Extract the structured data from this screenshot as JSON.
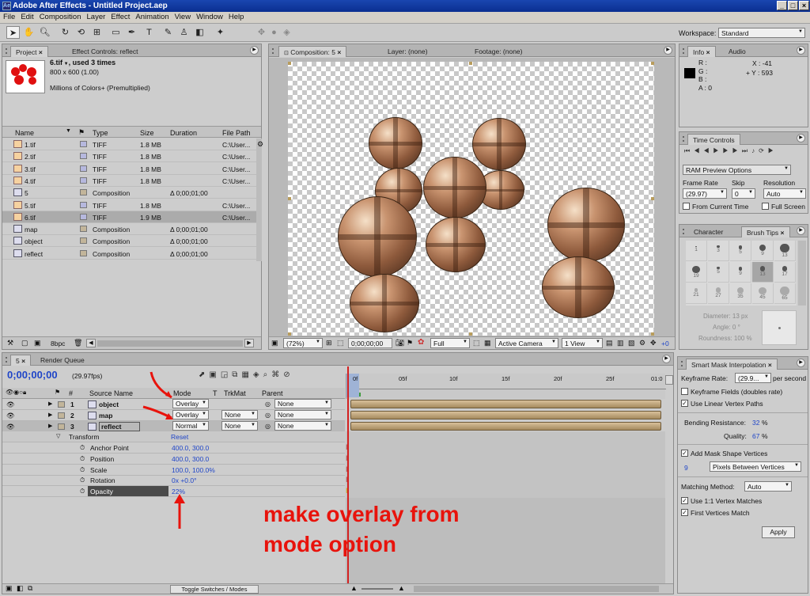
{
  "window": {
    "title": "Adobe After Effects - Untitled Project.aep"
  },
  "menu": [
    "File",
    "Edit",
    "Composition",
    "Layer",
    "Effect",
    "Animation",
    "View",
    "Window",
    "Help"
  ],
  "workspace": {
    "label": "Workspace:",
    "value": "Standard"
  },
  "project": {
    "tabs": [
      "Project",
      "Effect Controls: reflect"
    ],
    "item_name": "6.tif",
    "item_used": ", used 3 times",
    "item_size": "800 x 600 (1.00)",
    "item_color": "Millions of Colors+ (Premultiplied)",
    "columns": [
      "Name",
      "Type",
      "Size",
      "Duration",
      "File Path"
    ],
    "rows": [
      {
        "name": "1.tif",
        "type": "TIFF",
        "size": "1.8 MB",
        "duration": "",
        "path": "C:\\User...",
        "kind": "file"
      },
      {
        "name": "2.tif",
        "type": "TIFF",
        "size": "1.8 MB",
        "duration": "",
        "path": "C:\\User...",
        "kind": "file"
      },
      {
        "name": "3.tif",
        "type": "TIFF",
        "size": "1.8 MB",
        "duration": "",
        "path": "C:\\User...",
        "kind": "file"
      },
      {
        "name": "4.tif",
        "type": "TIFF",
        "size": "1.8 MB",
        "duration": "",
        "path": "C:\\User...",
        "kind": "file"
      },
      {
        "name": "5",
        "type": "Composition",
        "size": "",
        "duration": "Δ 0;00;01;00",
        "path": "",
        "kind": "comp"
      },
      {
        "name": "5.tif",
        "type": "TIFF",
        "size": "1.8 MB",
        "duration": "",
        "path": "C:\\User...",
        "kind": "file"
      },
      {
        "name": "6.tif",
        "type": "TIFF",
        "size": "1.9 MB",
        "duration": "",
        "path": "C:\\User...",
        "kind": "file"
      },
      {
        "name": "map",
        "type": "Composition",
        "size": "",
        "duration": "Δ 0;00;01;00",
        "path": "",
        "kind": "comp"
      },
      {
        "name": "object",
        "type": "Composition",
        "size": "",
        "duration": "Δ 0;00;01;00",
        "path": "",
        "kind": "comp"
      },
      {
        "name": "reflect",
        "type": "Composition",
        "size": "",
        "duration": "Δ 0;00;01;00",
        "path": "",
        "kind": "comp"
      }
    ],
    "bpc": "8bpc"
  },
  "viewer": {
    "tabs": [
      "Composition: 5",
      "Layer: (none)",
      "Footage: (none)"
    ],
    "zoom": "(72%)",
    "timecode": "0;00;00;00",
    "resolution": "Full",
    "camera": "Active Camera",
    "views": "1 View",
    "offset": "+0"
  },
  "info": {
    "tabs": [
      "Info",
      "Audio"
    ],
    "r": "R :",
    "g": "G :",
    "b": "B :",
    "a": "A : 0",
    "x": "X : -41",
    "y": "+ Y : 593"
  },
  "time_controls": {
    "title": "Time Controls",
    "ram_preview": "RAM Preview Options",
    "frame_rate_label": "Frame Rate",
    "frame_rate": "(29.97)",
    "skip_label": "Skip",
    "skip": "0",
    "resolution_label": "Resolution",
    "resolution": "Auto",
    "from_current": "From Current Time",
    "full_screen": "Full Screen"
  },
  "brush_tips": {
    "tabs": [
      "Character",
      "Brush Tips"
    ],
    "sizes": [
      "1",
      "3",
      "5",
      "9",
      "13",
      "19",
      "5",
      "9",
      "13",
      "17",
      "21",
      "27",
      "35",
      "45",
      "65"
    ],
    "diameter": "Diameter: 13 px",
    "angle": "Angle: 0 °",
    "roundness": "Roundness: 100 %"
  },
  "timeline": {
    "tabs": [
      "5",
      "Render Queue"
    ],
    "timecode": "0;00;00;00",
    "fps": "(29.97fps)",
    "columns": [
      "Source Name",
      "Mode",
      "T",
      "TrkMat",
      "Parent"
    ],
    "layers": [
      {
        "num": "1",
        "name": "object",
        "mode": "Overlay",
        "trkmat": "",
        "parent": "None"
      },
      {
        "num": "2",
        "name": "map",
        "mode": "Overlay",
        "trkmat": "None",
        "parent": "None"
      },
      {
        "num": "3",
        "name": "reflect",
        "mode": "Normal",
        "trkmat": "None",
        "parent": "None"
      }
    ],
    "transform": {
      "label": "Transform",
      "reset": "Reset"
    },
    "props": [
      {
        "name": "Anchor Point",
        "value": "400.0, 300.0"
      },
      {
        "name": "Position",
        "value": "400.0, 300.0"
      },
      {
        "name": "Scale",
        "value": "100.0, 100.0%"
      },
      {
        "name": "Rotation",
        "value": "0x +0.0°"
      },
      {
        "name": "Opacity",
        "value": "22%"
      }
    ],
    "ruler": [
      "0f",
      "05f",
      "10f",
      "15f",
      "20f",
      "25f",
      "01:0"
    ],
    "toggle": "Toggle Switches / Modes",
    "annotation_line1": "make overlay from",
    "annotation_line2": "mode option"
  },
  "smart_mask": {
    "title": "Smart Mask Interpolation",
    "keyframe_rate_label": "Keyframe Rate:",
    "keyframe_rate": "(29.9...",
    "per_second": "per second",
    "keyframe_fields": "Keyframe Fields (doubles rate)",
    "linear_paths": "Use Linear Vertex Paths",
    "bending_label": "Bending Resistance:",
    "bending": "32",
    "bending_unit": "%",
    "quality_label": "Quality:",
    "quality": "67",
    "quality_unit": "%",
    "add_vertices": "Add Mask Shape Vertices",
    "vertices_num": "9",
    "vertices_mode": "Pixels Between Vertices",
    "matching_label": "Matching Method:",
    "matching": "Auto",
    "one_to_one": "Use 1:1 Vertex Matches",
    "first_match": "First Vertices Match",
    "apply": "Apply"
  },
  "colors": {
    "title_bar": "#0b2f90",
    "link": "#1f45c8",
    "annotation": "#e8130c",
    "time_indicator": "#d42020",
    "layer_bar": "#c3a87e"
  }
}
